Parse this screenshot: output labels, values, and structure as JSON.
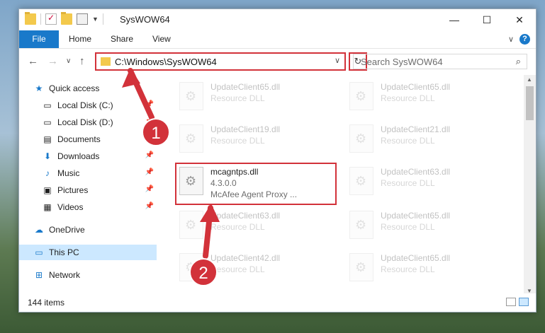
{
  "window": {
    "title": "SysWOW64",
    "minimize_glyph": "—",
    "maximize_glyph": "☐",
    "close_glyph": "✕"
  },
  "ribbon": {
    "tabs": [
      "File",
      "Home",
      "Share",
      "View"
    ],
    "collapse_glyph": "∨",
    "help_glyph": "?"
  },
  "nav": {
    "back_glyph": "←",
    "forward_glyph": "→",
    "recent_glyph": "∨",
    "up_glyph": "↑",
    "address_path": "C:\\Windows\\SysWOW64",
    "address_dropdown_glyph": "∨",
    "refresh_glyph": "↻",
    "search_placeholder": "Search SysWOW64",
    "search_glyph": "⌕"
  },
  "sidebar": {
    "items": [
      {
        "label": "Quick access",
        "icon": "star-icon",
        "glyph": "★",
        "pinned": false
      },
      {
        "label": "Local Disk (C:)",
        "icon": "drive-icon",
        "glyph": "▭",
        "pinned": true
      },
      {
        "label": "Local Disk (D:)",
        "icon": "drive-icon",
        "glyph": "▭",
        "pinned": true
      },
      {
        "label": "Documents",
        "icon": "documents-icon",
        "glyph": "▤",
        "pinned": true
      },
      {
        "label": "Downloads",
        "icon": "downloads-icon",
        "glyph": "⬇",
        "pinned": true
      },
      {
        "label": "Music",
        "icon": "music-icon",
        "glyph": "♪",
        "pinned": true
      },
      {
        "label": "Pictures",
        "icon": "pictures-icon",
        "glyph": "▣",
        "pinned": true
      },
      {
        "label": "Videos",
        "icon": "videos-icon",
        "glyph": "▦",
        "pinned": true
      },
      {
        "label": "OneDrive",
        "icon": "onedrive-icon",
        "glyph": "☁",
        "pinned": false
      },
      {
        "label": "This PC",
        "icon": "computer-icon",
        "glyph": "▭",
        "pinned": false
      },
      {
        "label": "Network",
        "icon": "network-icon",
        "glyph": "⊞",
        "pinned": false
      }
    ],
    "pin_glyph": "📌"
  },
  "files": [
    {
      "name": "UpdateClient65.dll",
      "type": "Resource DLL",
      "faded": true
    },
    {
      "name": "UpdateClient65.dll",
      "type": "Resource DLL",
      "faded": true
    },
    {
      "name": "UpdateClient19.dll",
      "type": "Resource DLL",
      "faded": true
    },
    {
      "name": "UpdateClient21.dll",
      "type": "Resource DLL",
      "faded": true
    },
    {
      "name": "mcagntps.dll",
      "type": "4.3.0.0",
      "desc": "McAfee Agent Proxy ...",
      "faded": false
    },
    {
      "name": "UpdateClient63.dll",
      "type": "Resource DLL",
      "faded": true
    },
    {
      "name": "UpdateClient63.dll",
      "type": "Resource DLL",
      "faded": true
    },
    {
      "name": "UpdateClient65.dll",
      "type": "Resource DLL",
      "faded": true
    },
    {
      "name": "UpdateClient42.dll",
      "type": "Resource DLL",
      "faded": true
    },
    {
      "name": "UpdateClient65.dll",
      "type": "Resource DLL",
      "faded": true
    }
  ],
  "status": {
    "item_count": "144 items"
  },
  "annotations": {
    "step1": "1",
    "step2": "2",
    "color": "#d2323a"
  }
}
